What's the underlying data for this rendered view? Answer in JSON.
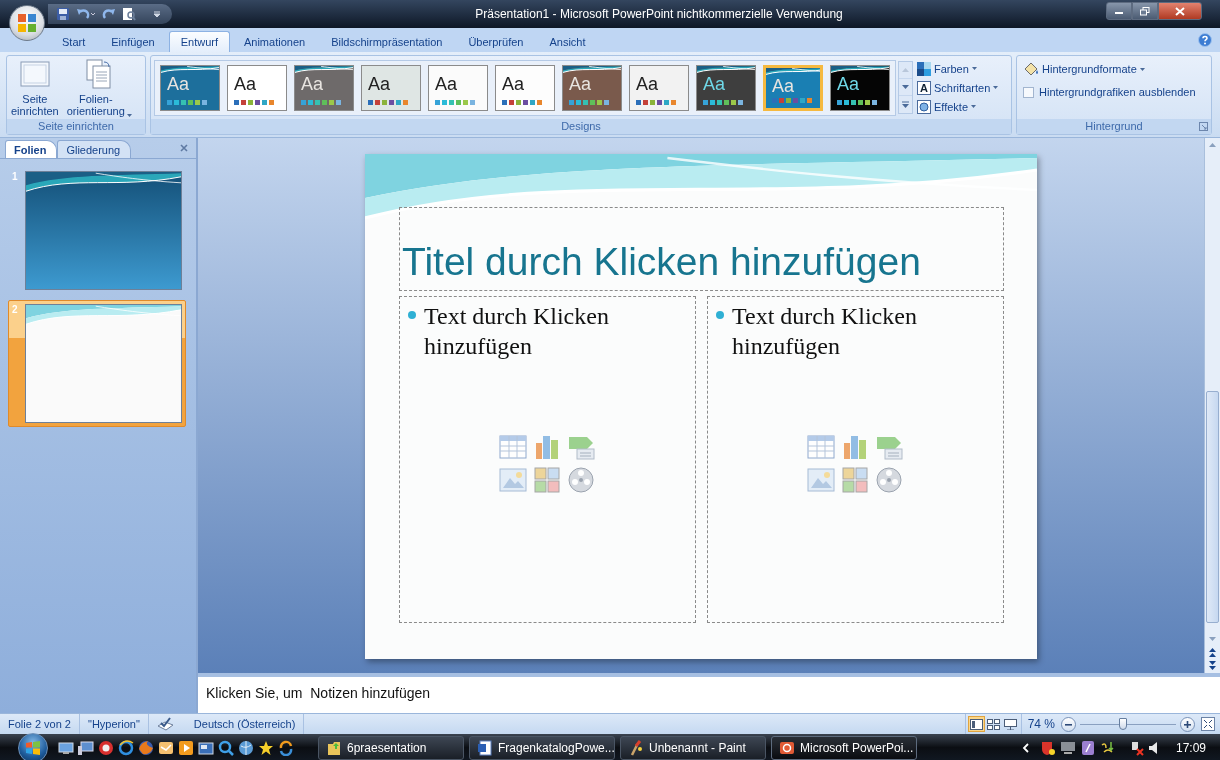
{
  "window": {
    "title": "Präsentation1 - Microsoft PowerPoint nichtkommerzielle Verwendung"
  },
  "ribbon_tabs": [
    {
      "label": "Start",
      "selected": false
    },
    {
      "label": "Einfügen",
      "selected": false
    },
    {
      "label": "Entwurf",
      "selected": true
    },
    {
      "label": "Animationen",
      "selected": false
    },
    {
      "label": "Bildschirmpräsentation",
      "selected": false
    },
    {
      "label": "Überprüfen",
      "selected": false
    },
    {
      "label": "Ansicht",
      "selected": false
    }
  ],
  "page_setup": {
    "label": "Seite einrichten",
    "buttons": [
      {
        "label": "Seite\neinrichten",
        "kind": "page",
        "dropdown": false
      },
      {
        "label": "Folien-\norientierung",
        "kind": "orientation",
        "dropdown": true
      }
    ]
  },
  "designs": {
    "label": "Designs",
    "themes": [
      {
        "label": "Aa",
        "color": "#1d6f9c",
        "selected": false
      },
      {
        "label": "Aa",
        "color": "#ffffff",
        "selected": false
      },
      {
        "label": "Aa",
        "color": "#6e6a6a",
        "selected": false
      },
      {
        "label": "Aa",
        "color": "#dfe6e4",
        "selected": false
      },
      {
        "label": "Aa",
        "color": "#fbfbfb",
        "selected": false
      },
      {
        "label": "Aa",
        "color": "#fdfdfd",
        "selected": false
      },
      {
        "label": "Aa",
        "color": "#7a5a4c",
        "selected": false
      },
      {
        "label": "Aa",
        "color": "#f2f2f2",
        "selected": false
      },
      {
        "label": "Aa",
        "color": "#3e3e3e",
        "selected": false
      },
      {
        "label": "Aa",
        "color": "#1a7fb3",
        "selected": true
      },
      {
        "label": "Aa",
        "color": "#050505",
        "selected": false
      }
    ],
    "options": [
      {
        "label": "Farben",
        "kind": "colors"
      },
      {
        "label": "Schriftarten",
        "kind": "fonts",
        "glyph": "A"
      },
      {
        "label": "Effekte",
        "kind": "effects"
      }
    ]
  },
  "background": {
    "label": "Hintergrund",
    "format_button": "Hintergrundformate",
    "hide_graphics": {
      "label": "Hintergrundgrafiken ausblenden",
      "checked": false
    }
  },
  "slides_panel": {
    "tabs": [
      {
        "label": "Folien",
        "selected": true
      },
      {
        "label": "Gliederung",
        "selected": false
      }
    ],
    "thumbnails": [
      {
        "number": "1",
        "kind": "title",
        "selected": false
      },
      {
        "number": "2",
        "kind": "content",
        "selected": true
      }
    ]
  },
  "slide": {
    "title": "Titel durch Klicken hinzufügen",
    "placeholders": [
      {
        "text": "Text durch Klicken hinzufügen"
      },
      {
        "text": "Text durch Klicken hinzufügen"
      }
    ]
  },
  "notes": {
    "placeholder": "Klicken Sie, um  Notizen hinzufügen"
  },
  "status_bar": {
    "slide_info": "Folie 2 von 2",
    "theme": "\"Hyperion\"",
    "language": "Deutsch (Österreich)",
    "views": [
      {
        "kind": "normal",
        "selected": true
      },
      {
        "kind": "sorter",
        "selected": false
      },
      {
        "kind": "show",
        "selected": false
      }
    ],
    "zoom": "74 %",
    "zoom_slider": {
      "level": 0.45
    }
  },
  "taskbar": {
    "tasks": [
      {
        "label": "6praesentation",
        "kind": "folder",
        "selected": false
      },
      {
        "label": "FragenkatalogPowe...",
        "kind": "word",
        "selected": false
      },
      {
        "label": "Unbenannt - Paint",
        "kind": "paint",
        "selected": false
      },
      {
        "label": "Microsoft PowerPoi...",
        "kind": "powerpoint",
        "selected": true
      }
    ],
    "clock": "17:09"
  }
}
